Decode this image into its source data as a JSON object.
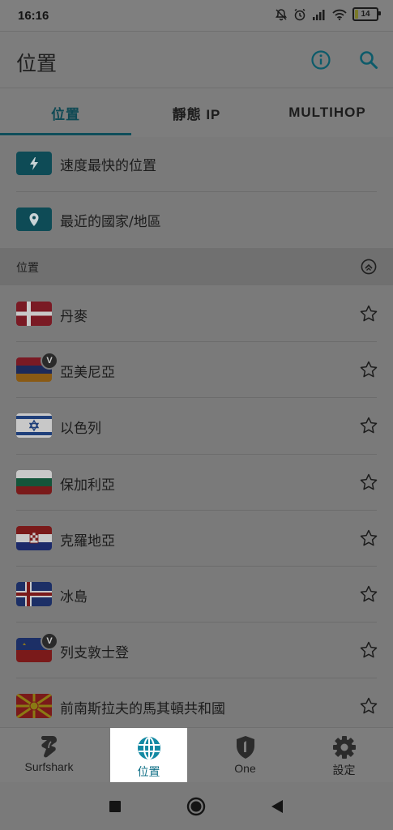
{
  "status": {
    "time": "16:16",
    "battery": "14"
  },
  "appbar": {
    "title": "位置"
  },
  "tabs": [
    {
      "label": "位置",
      "active": true
    },
    {
      "label": "靜態 IP",
      "active": false
    },
    {
      "label": "MULTIHOP",
      "active": false
    }
  ],
  "quick_actions": [
    {
      "label": "速度最快的位置",
      "icon": "bolt-icon"
    },
    {
      "label": "最近的國家/地區",
      "icon": "location-pin-icon"
    }
  ],
  "section": {
    "label": "位置"
  },
  "countries": [
    {
      "name": "丹麥",
      "flag": "denmark",
      "virtual": false
    },
    {
      "name": "亞美尼亞",
      "flag": "armenia",
      "virtual": true,
      "badge": "V"
    },
    {
      "name": "以色列",
      "flag": "israel",
      "virtual": false
    },
    {
      "name": "保加利亞",
      "flag": "bulgaria",
      "virtual": false
    },
    {
      "name": "克羅地亞",
      "flag": "croatia",
      "virtual": false
    },
    {
      "name": "冰島",
      "flag": "iceland",
      "virtual": false
    },
    {
      "name": "列支敦士登",
      "flag": "liechtenstein",
      "virtual": true,
      "badge": "V"
    },
    {
      "name": "前南斯拉夫的馬其頓共和國",
      "flag": "north-macedonia",
      "virtual": false
    }
  ],
  "bottom_nav": [
    {
      "label": "Surfshark",
      "icon": "surfshark-logo-icon",
      "active": false
    },
    {
      "label": "位置",
      "icon": "globe-icon",
      "active": true
    },
    {
      "label": "One",
      "icon": "shield-one-icon",
      "active": false
    },
    {
      "label": "設定",
      "icon": "gear-icon",
      "active": false
    }
  ],
  "colors": {
    "accent": "#0f4e5a",
    "active_nav": "#0f6f86",
    "overlay": "#7a7a7a"
  }
}
